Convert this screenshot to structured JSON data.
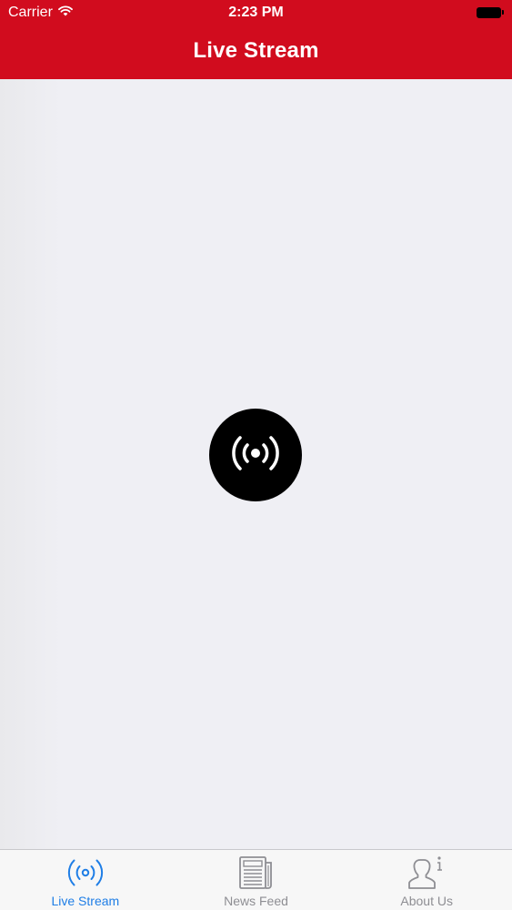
{
  "status_bar": {
    "carrier": "Carrier",
    "time": "2:23 PM"
  },
  "header": {
    "title": "Live Stream",
    "background_color": "#d10c1e"
  },
  "main": {
    "live_button_icon": "broadcast-icon"
  },
  "tabbar": {
    "active_color": "#1f7ee6",
    "inactive_color": "#8e8e93",
    "tabs": [
      {
        "label": "Live Stream",
        "icon": "broadcast-icon",
        "active": true
      },
      {
        "label": "News Feed",
        "icon": "newspaper-icon",
        "active": false
      },
      {
        "label": "About Us",
        "icon": "person-info-icon",
        "active": false
      }
    ]
  }
}
